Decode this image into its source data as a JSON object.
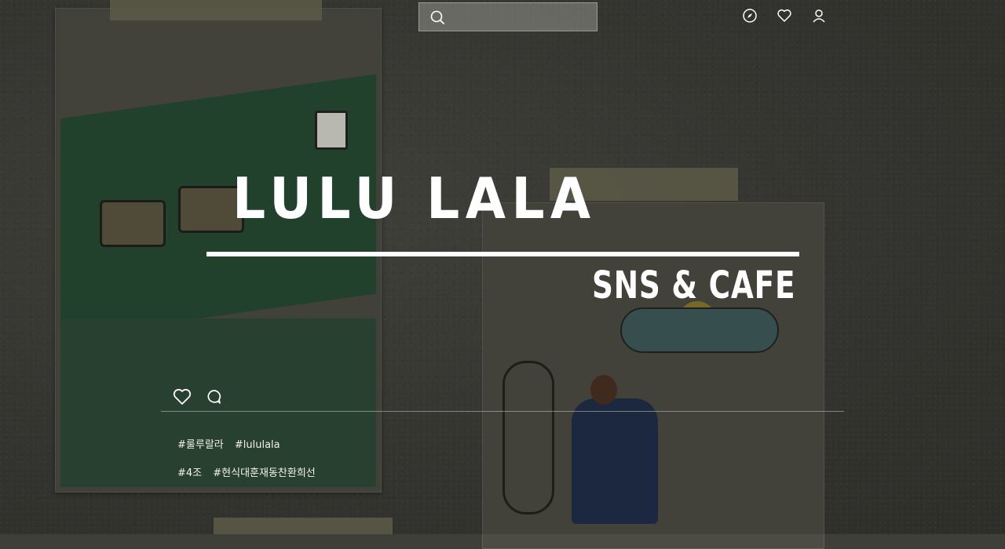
{
  "search": {
    "placeholder": "",
    "icon": "search-icon"
  },
  "top_nav": {
    "icons": [
      "compass-icon",
      "heart-icon",
      "user-icon"
    ]
  },
  "hero": {
    "title": "LULU LALA",
    "subtitle": "SNS & CAFE"
  },
  "post": {
    "actions": [
      "heart-icon",
      "comment-icon"
    ],
    "tags_line1": [
      "#룰루랄라",
      "#lululala"
    ],
    "tags_line2": [
      "#4조",
      "#현식대훈재동찬환희선"
    ]
  },
  "colors": {
    "text": "#ffffff",
    "background": "#3f3f3a",
    "search_bg": "rgba(200,200,195,0.35)"
  }
}
